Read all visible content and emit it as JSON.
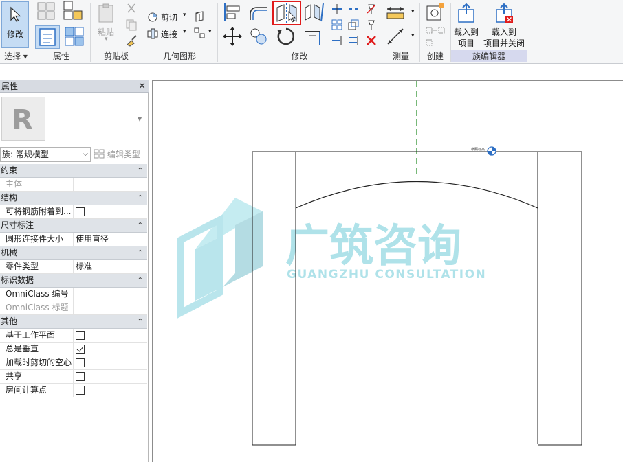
{
  "ribbon": {
    "select_panel": {
      "modify_label": "修改",
      "panel_label": "选择 ▾"
    },
    "properties_panel": {
      "panel_label": "属性"
    },
    "clipboard_panel": {
      "paste_label": "粘贴",
      "panel_label": "剪贴板"
    },
    "geometry_panel": {
      "cut_label": "剪切",
      "join_label": "连接",
      "panel_label": "几何图形"
    },
    "modify_panel": {
      "panel_label": "修改"
    },
    "measure_panel": {
      "panel_label": "测量"
    },
    "create_panel": {
      "panel_label": "创建"
    },
    "family_editor_panel": {
      "load_project_line1": "载入到",
      "load_project_line2": "项目",
      "load_close_line1": "载入到",
      "load_close_line2": "项目并关闭",
      "panel_label": "族编辑器"
    }
  },
  "properties": {
    "title": "属性",
    "close": "×",
    "preview_letter": "R",
    "family_selector": "族: 常规模型",
    "edit_type": "编辑类型",
    "groups": [
      {
        "name": "约束",
        "rows": [
          {
            "key": "主体",
            "value": "",
            "disabled": true,
            "type": "text"
          }
        ]
      },
      {
        "name": "结构",
        "rows": [
          {
            "key": "可将钢筋附着到...",
            "value": false,
            "disabled": false,
            "type": "checkbox"
          }
        ]
      },
      {
        "name": "尺寸标注",
        "rows": [
          {
            "key": "圆形连接件大小",
            "value": "使用直径",
            "disabled": false,
            "type": "text"
          }
        ]
      },
      {
        "name": "机械",
        "rows": [
          {
            "key": "零件类型",
            "value": "标准",
            "disabled": false,
            "type": "text"
          }
        ]
      },
      {
        "name": "标识数据",
        "rows": [
          {
            "key": "OmniClass 编号",
            "value": "",
            "disabled": false,
            "type": "text"
          },
          {
            "key": "OmniClass 标题",
            "value": "",
            "disabled": true,
            "type": "text"
          }
        ]
      },
      {
        "name": "其他",
        "rows": [
          {
            "key": "基于工作平面",
            "value": false,
            "disabled": false,
            "type": "checkbox"
          },
          {
            "key": "总是垂直",
            "value": true,
            "disabled": false,
            "type": "checkbox"
          },
          {
            "key": "加载时剪切的空心",
            "value": false,
            "disabled": false,
            "type": "checkbox"
          },
          {
            "key": "共享",
            "value": false,
            "disabled": false,
            "type": "checkbox"
          },
          {
            "key": "房间计算点",
            "value": false,
            "disabled": false,
            "type": "checkbox"
          }
        ]
      }
    ]
  },
  "canvas": {
    "ref_label": "参照标高",
    "watermark": {
      "title": "广筑咨询",
      "subtitle": "GUANGZHU CONSULTATION"
    }
  },
  "colors": {
    "accent_blue": "#2d6fc4",
    "highlight_red": "#e01c1c",
    "ref_plane_green": "#1f8a1f",
    "watermark_teal": "#3ab7c9"
  }
}
